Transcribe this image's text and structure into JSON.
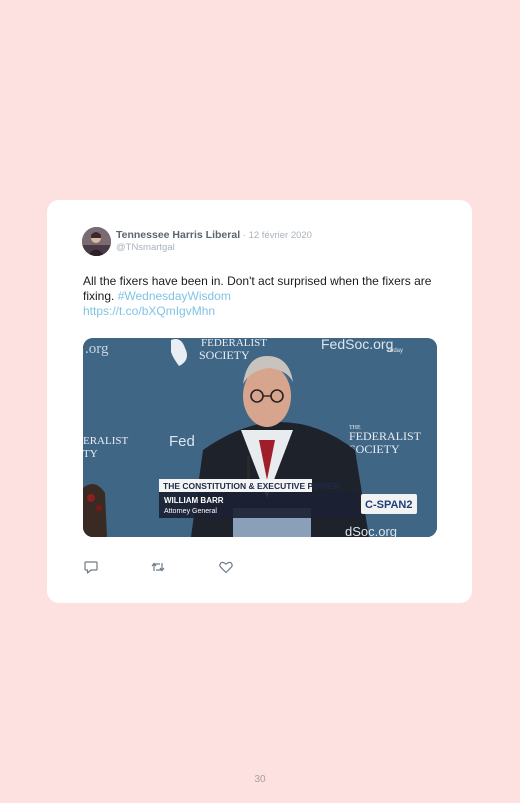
{
  "tweet": {
    "author_name": "Tennessee Harris Liberal",
    "date": "12 février 2020",
    "handle": "@TNsmartgal",
    "text_main": "All the fixers have been in. Don't act surprised when the fixers are fixing. ",
    "hashtag": "#WednesdayWisdom",
    "url": "https://t.co/bXQmIgvMhn"
  },
  "media": {
    "org_top_left": ".org",
    "fed_society_line1": "FEDERALIST",
    "fed_society_line2": "SOCIETY",
    "fedsoc_top_right": "FedSoc.org",
    "today": "Today",
    "left_line1": "ERALIST",
    "left_line2": "TY",
    "fed_middle": "Fed",
    "right_the": "THE",
    "right_line1": "FEDERALIST",
    "right_line2": "SOCIETY",
    "banner": "THE CONSTITUTION & EXECUTIVE POWER",
    "speaker_name": "WILLIAM BARR",
    "speaker_title": "Attorney General",
    "network": "C-SPAN2",
    "fedsoc_bottom": "dSoc.org"
  },
  "actions": {
    "reply_icon": "reply-icon",
    "retweet_icon": "retweet-icon",
    "like_icon": "heart-icon"
  },
  "page": {
    "number": "30"
  }
}
